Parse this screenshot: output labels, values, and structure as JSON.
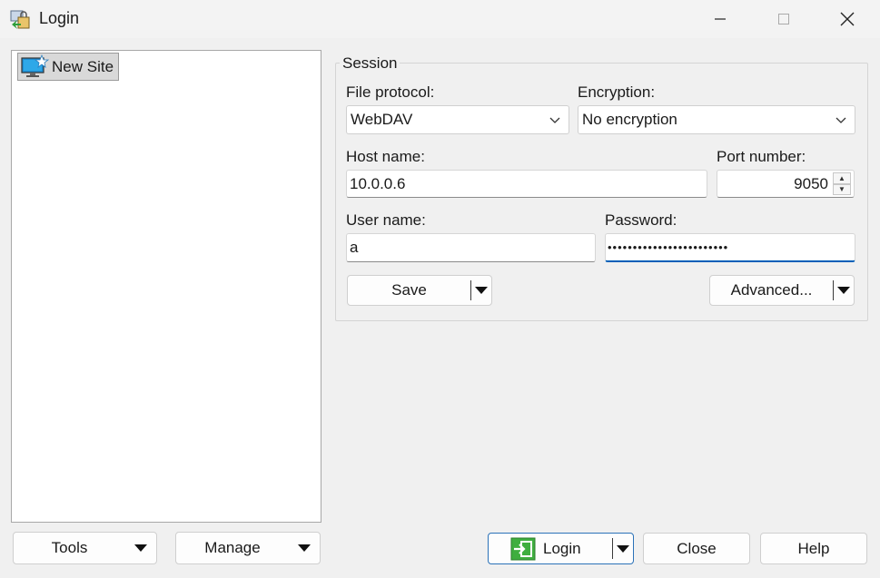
{
  "window": {
    "title": "Login"
  },
  "site_tree": {
    "items": [
      {
        "label": "New Site"
      }
    ]
  },
  "session": {
    "legend": "Session",
    "file_protocol": {
      "label": "File protocol:",
      "value": "WebDAV"
    },
    "encryption": {
      "label": "Encryption:",
      "value": "No encryption"
    },
    "host": {
      "label": "Host name:",
      "value": "10.0.0.6"
    },
    "port": {
      "label": "Port number:",
      "value": "9050"
    },
    "user": {
      "label": "User name:",
      "value": "a"
    },
    "password": {
      "label": "Password:",
      "masked": "••••••••••••••••••••••••"
    },
    "save_label": "Save",
    "advanced_label": "Advanced..."
  },
  "bottom": {
    "tools_label": "Tools",
    "manage_label": "Manage",
    "login_label": "Login",
    "close_label": "Close",
    "help_label": "Help"
  },
  "colors": {
    "accent": "#005fb8",
    "login_green": "#3fae3f"
  }
}
